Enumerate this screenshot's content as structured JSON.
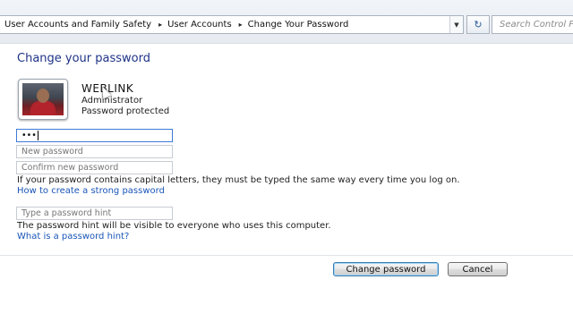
{
  "breadcrumb": {
    "items": [
      "User Accounts and Family Safety",
      "User Accounts",
      "Change Your Password"
    ],
    "separator": "▸"
  },
  "search": {
    "placeholder": "Search Control Panel"
  },
  "page": {
    "title": "Change your password"
  },
  "user": {
    "name": "WEBLINK",
    "role": "Administrator",
    "status": "Password protected"
  },
  "fields": {
    "current_password": {
      "value": "•••"
    },
    "new_password": {
      "placeholder": "New password"
    },
    "confirm_password": {
      "placeholder": "Confirm new password"
    },
    "hint": {
      "placeholder": "Type a password hint"
    }
  },
  "notes": {
    "capital_letters": "If your password contains capital letters, they must be typed the same way every time you log on.",
    "strong_password_link": "How to create a strong password",
    "hint_visible": "The password hint will be visible to everyone who uses this computer.",
    "what_is_hint_link": "What is a password hint?"
  },
  "buttons": {
    "change": "Change password",
    "cancel": "Cancel"
  },
  "colors": {
    "title": "#1e3287",
    "link": "#1a56b8",
    "focus_border": "#3d7bd8"
  }
}
